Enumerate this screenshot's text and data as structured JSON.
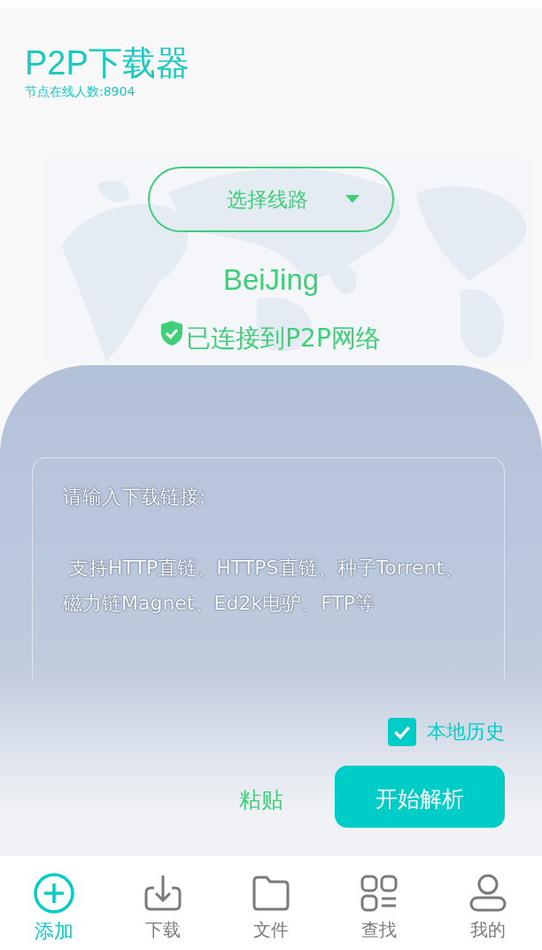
{
  "header": {
    "title": "P2P下载器",
    "subtitle": "节点在线人数:8904"
  },
  "route_select": {
    "label": "选择线路"
  },
  "location": "BeiJing",
  "status": "已连接到P2P网络",
  "link_input": {
    "placeholder": "请输入下载链接:\n\n 支持HTTP直链、HTTPS直链、种子Torrent、磁力链Magnet、Ed2k电驴、FTP等"
  },
  "local_history": {
    "label": "本地历史",
    "checked": true
  },
  "paste": "粘贴",
  "start_button": "开始解析",
  "nav": [
    {
      "label": "添加",
      "selected": true
    },
    {
      "label": "下载",
      "selected": false
    },
    {
      "label": "文件",
      "selected": false
    },
    {
      "label": "查找",
      "selected": false
    },
    {
      "label": "我的",
      "selected": false
    }
  ]
}
